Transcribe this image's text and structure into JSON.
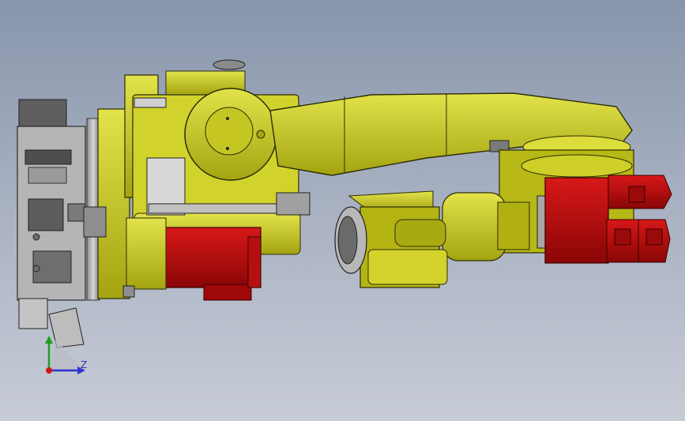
{
  "viewport": {
    "background_top": "#8895ab",
    "background_bottom": "#c7ccd6"
  },
  "model": {
    "colors": {
      "yellow": "#c8c81a",
      "yellow_light": "#dede40",
      "yellow_dark": "#8f8f10",
      "red": "#c00d0d",
      "red_dark": "#7e0505",
      "grey": "#a9a9a9",
      "grey_dark": "#595959",
      "outline": "#2c2c08"
    }
  },
  "triad": {
    "z_label": "Z",
    "y_color": "#1f9f1f",
    "z_color": "#2c34d0",
    "x_color": "#d01818"
  }
}
